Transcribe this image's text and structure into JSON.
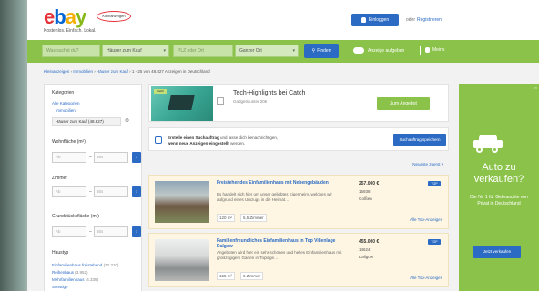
{
  "header": {
    "logo": {
      "e": "e",
      "b": "b",
      "a": "a",
      "y": "y"
    },
    "badge": "Kleinanzeigen",
    "tagline": "Kostenlos. Einfach. Lokal.",
    "login_label": "Einloggen",
    "or_text": "oder",
    "register_label": "Registrieren"
  },
  "search": {
    "query_placeholder": "Was suchst du?",
    "category_value": "Häuser zum Kauf",
    "location_placeholder": "PLZ oder Ort",
    "radius_value": "Ganzer Ort",
    "find_label": "Finden",
    "post_ad_label": "Anzeige aufgeben",
    "my_ads_label": "Meins"
  },
  "breadcrumb": {
    "item1": "Kleinanzeigen",
    "item2": "Immobilien",
    "item3": "Häuser zum Kauf",
    "result_text": "1 - 25 von 48.827 Anzeigen in Deutschland"
  },
  "sidebar": {
    "categories_heading": "Kategorien",
    "all_categories": "Alle Kategorien",
    "immobilien": "Immobilien",
    "selected_tag": "Häuser zum Kauf (48.827)",
    "living_area_heading": "Wohnfläche (m²)",
    "rooms_heading": "Zimmer",
    "plot_heading": "Grundstücksfläche (m²)",
    "from_placeholder": "Ab",
    "to_placeholder": "Bis",
    "house_type_heading": "Haustyp",
    "house_types": [
      {
        "label": "Einfamilienhaus freistehend",
        "count": "(22.310)"
      },
      {
        "label": "Reihenhaus",
        "count": "(3.952)"
      },
      {
        "label": "Mehrfamilienhaus",
        "count": "(4.339)"
      },
      {
        "label": "Sonstige",
        "count": ""
      }
    ]
  },
  "ad_card": {
    "tag": "Catch",
    "title": "Tech-Highlights bei Catch",
    "subtitle": "Gadgets unter 20€",
    "cta": "Zum Angebot"
  },
  "alert": {
    "line1_bold": "Erstelle einen Suchauftrag",
    "line1_rest": "und lasse dich benachrichtigen,",
    "line2_bold": "wenn neue Anzeigen eingestellt",
    "line2_rest": "werden.",
    "button": "Suchauftrag speichern"
  },
  "sort": "Neueste zuerst ▾",
  "listings": [
    {
      "title": "Freistehendes Einfamilienhaus mit Nebengebäuden",
      "desc": "Es handelt sich hier um unser geliebtes Eigenheim, welches wir aufgrund eines Umzugs in die Heimat…",
      "area": "120 m²",
      "rooms": "5,5 Zimmer",
      "price": "257.000 €",
      "zip": "15938",
      "city": "Golßen",
      "badge": "TOP",
      "more": "Alle Top-Anzeigen"
    },
    {
      "title": "Familienfreundliches Einfamilienhaus in Top Villenlage Dalgow",
      "desc": "Angeboten wird hier ein sehr schönes und helles Einfamilienhaus mit großzügigem Garten in Toplage…",
      "area": "155 m²",
      "rooms": "6 Zimmer",
      "price": "455.000 €",
      "zip": "14624",
      "city": "Dallgow",
      "badge": "TOP",
      "more": "Alle Top-Anzeigen"
    }
  ],
  "banner": {
    "close": "i ×",
    "headline": "Auto zu verkaufen?",
    "text": "Die Nr. 1 für Gebrauchte von Privat in Deutschland",
    "button": "Jetzt verkaufen"
  },
  "colors": {
    "green": "#8bc34a",
    "blue": "#2b6bc4",
    "listing_bg": "#fef6e3"
  }
}
